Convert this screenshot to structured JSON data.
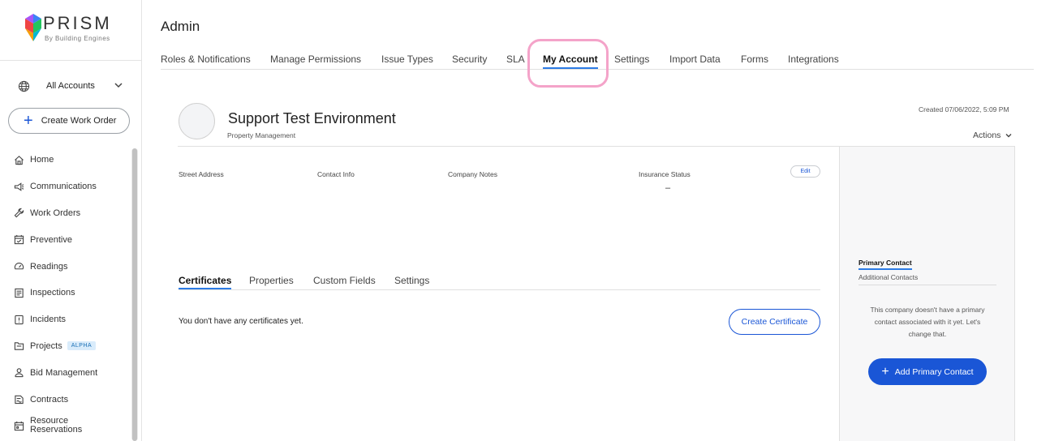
{
  "brand": {
    "name": "PRISM",
    "tagline": "By Building Engines",
    "accent": "#1a56d6"
  },
  "sidebar": {
    "account_selector": "All Accounts",
    "create_work_order": "Create Work Order",
    "items": [
      {
        "label": "Home",
        "icon": "home-icon"
      },
      {
        "label": "Communications",
        "icon": "megaphone-icon"
      },
      {
        "label": "Work Orders",
        "icon": "wrench-icon"
      },
      {
        "label": "Preventive",
        "icon": "calendar-check-icon"
      },
      {
        "label": "Readings",
        "icon": "gauge-icon"
      },
      {
        "label": "Inspections",
        "icon": "clipboard-icon"
      },
      {
        "label": "Incidents",
        "icon": "alert-icon"
      },
      {
        "label": "Projects",
        "icon": "folder-icon",
        "badge": "ALPHA"
      },
      {
        "label": "Bid Management",
        "icon": "user-icon"
      },
      {
        "label": "Contracts",
        "icon": "contract-icon"
      },
      {
        "label": "Resource Reservations",
        "icon": "calendar-icon"
      }
    ]
  },
  "header": {
    "title": "Admin",
    "tabs": [
      "Roles & Notifications",
      "Manage Permissions",
      "Issue Types",
      "Security",
      "SLA",
      "My Account",
      "Settings",
      "Import Data",
      "Forms",
      "Integrations"
    ],
    "active_tab": "My Account"
  },
  "company": {
    "name": "Support Test Environment",
    "type": "Property Management",
    "created": "Created 07/06/2022, 5:09 PM",
    "actions_label": "Actions"
  },
  "details": {
    "street_address_label": "Street Address",
    "contact_info_label": "Contact Info",
    "company_notes_label": "Company Notes",
    "insurance_status_label": "Insurance Status",
    "insurance_status_value": "–",
    "edit_label": "Edit"
  },
  "sub_tabs": {
    "items": [
      "Certificates",
      "Properties",
      "Custom Fields",
      "Settings"
    ],
    "active": "Certificates"
  },
  "certificates": {
    "empty_message": "You don't have any certificates yet.",
    "create_button": "Create Certificate"
  },
  "contacts": {
    "primary_tab": "Primary Contact",
    "additional_tab": "Additional Contacts",
    "empty_message": "This company doesn't have a primary contact associated with it yet. Let's change that.",
    "add_button": "Add Primary Contact"
  }
}
